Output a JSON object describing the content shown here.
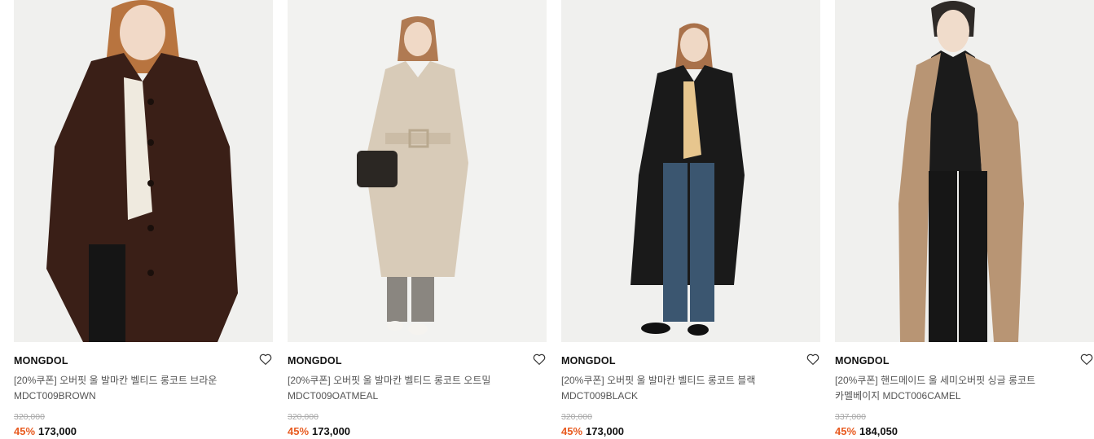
{
  "colors": {
    "discount": "#e85a1f",
    "brand_text": "#111111",
    "name_text": "#555555",
    "original_price": "#aaaaaa",
    "photo_bg": "#f0f0ee"
  },
  "icons": {
    "wishlist": "heart-outline-icon"
  },
  "products": [
    {
      "brand": "MONGDOL",
      "name_line1": "[20%쿠폰] 오버핏 울 발마칸 벨티드 롱코트 브라운",
      "name_line2": "MDCT009BROWN",
      "original_price": "320,000",
      "discount": "45%",
      "sale_price": "173,000",
      "coat_color": "#3a1f17"
    },
    {
      "brand": "MONGDOL",
      "name_line1": "[20%쿠폰] 오버핏 울 발마칸 벨티드 롱코트 오트밀",
      "name_line2": "MDCT009OATMEAL",
      "original_price": "320,000",
      "discount": "45%",
      "sale_price": "173,000",
      "coat_color": "#d8cbb8"
    },
    {
      "brand": "MONGDOL",
      "name_line1": "[20%쿠폰] 오버핏 울 발마칸 벨티드 롱코트 블랙",
      "name_line2": "MDCT009BLACK",
      "original_price": "320,000",
      "discount": "45%",
      "sale_price": "173,000",
      "coat_color": "#1a1a1a"
    },
    {
      "brand": "MONGDOL",
      "name_line1": "[20%쿠폰] 핸드메이드 울 세미오버핏 싱글 롱코트",
      "name_line2": "카멜베이지 MDCT006CAMEL",
      "original_price": "337,000",
      "discount": "45%",
      "sale_price": "184,050",
      "coat_color": "#b89574"
    }
  ]
}
